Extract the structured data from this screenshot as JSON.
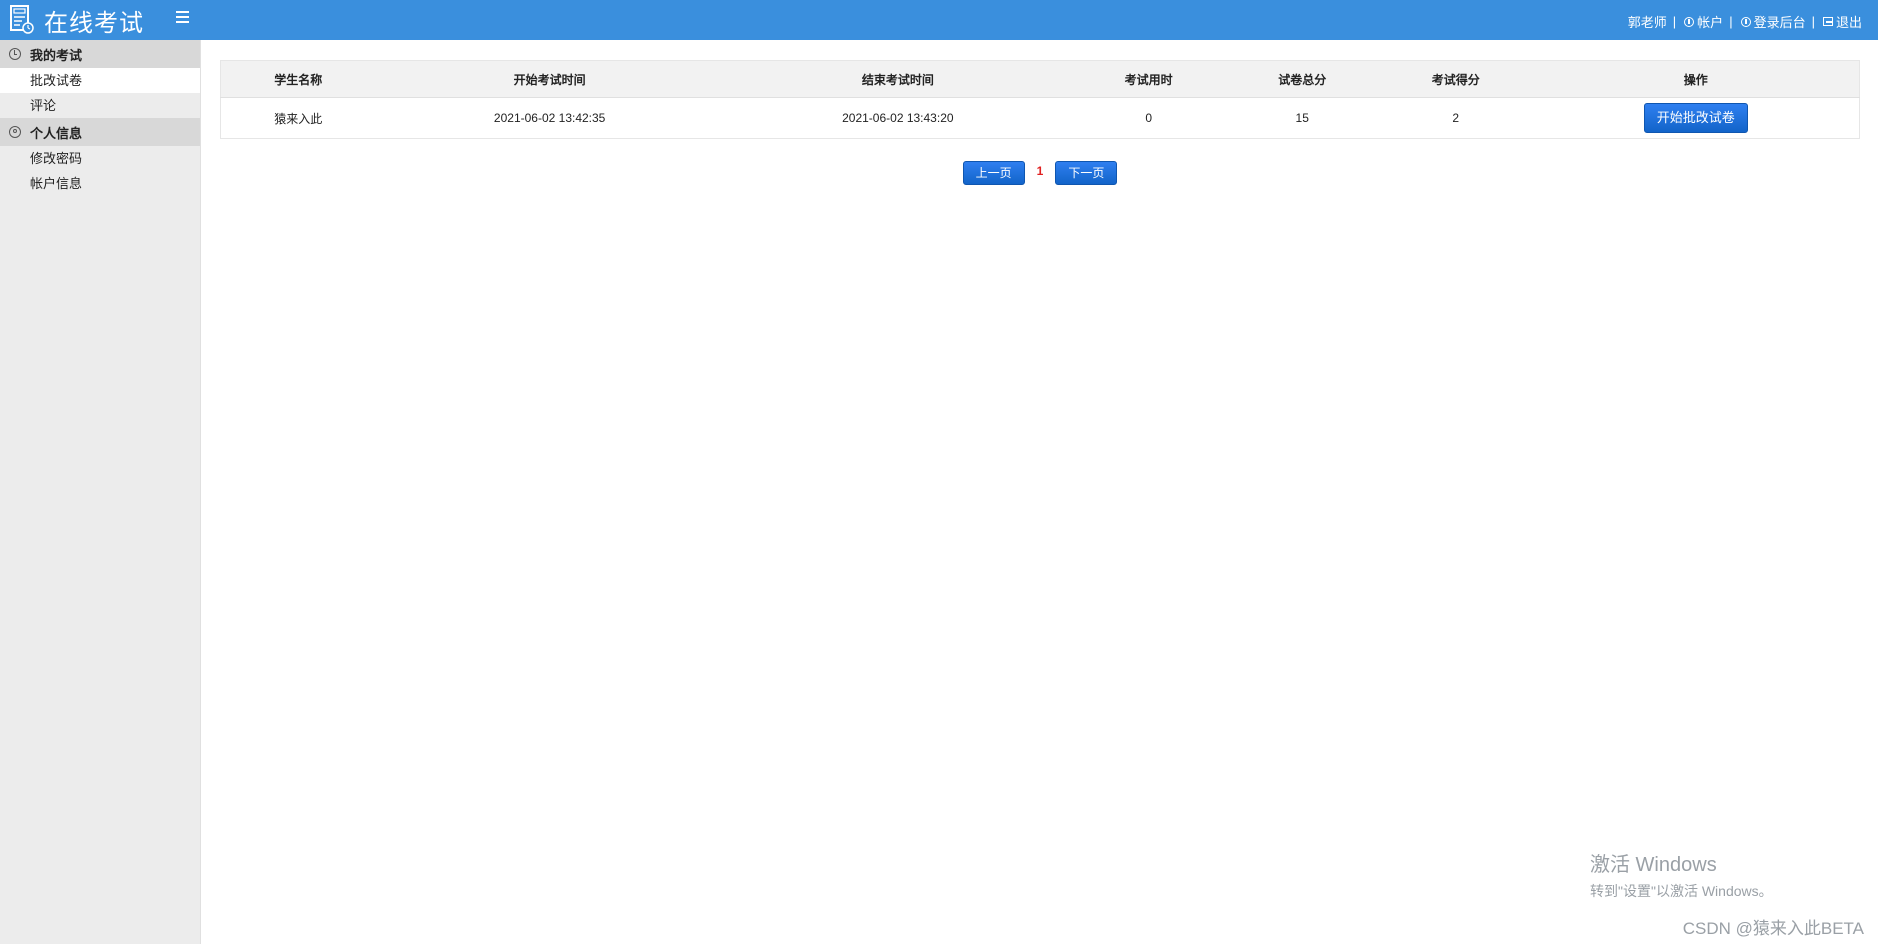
{
  "header": {
    "title": "在线考试",
    "user_name": "郭老师",
    "account_label": "帐户",
    "admin_label": "登录后台",
    "logout_label": "退出",
    "separator": "|"
  },
  "sidebar": {
    "groups": [
      {
        "label": "我的考试",
        "icon": "clock-icon",
        "items": [
          {
            "label": "批改试卷"
          },
          {
            "label": "评论"
          }
        ]
      },
      {
        "label": "个人信息",
        "icon": "user-icon",
        "items": [
          {
            "label": "修改密码"
          },
          {
            "label": "帐户信息"
          }
        ]
      }
    ]
  },
  "table": {
    "headers": [
      "学生名称",
      "开始考试时间",
      "结束考试时间",
      "考试用时",
      "试卷总分",
      "考试得分",
      "操作"
    ],
    "rows": [
      {
        "student": "猿来入此",
        "start_time": "2021-06-02 13:42:35",
        "end_time": "2021-06-02 13:43:20",
        "duration": "0",
        "total_score": "15",
        "score": "2",
        "action_label": "开始批改试卷"
      }
    ]
  },
  "pager": {
    "prev_label": "上一页",
    "current_page": "1",
    "next_label": "下一页"
  },
  "overlay": {
    "activation_title": "激活 Windows",
    "activation_hint": "转到\"设置\"以激活 Windows。",
    "csdn_mark": "CSDN @猿来入此BETA"
  },
  "colors": {
    "topbar": "#3a8fdd",
    "button": "#1b6fd6",
    "page_number": "#e02020",
    "sidebar": "#ececec"
  }
}
